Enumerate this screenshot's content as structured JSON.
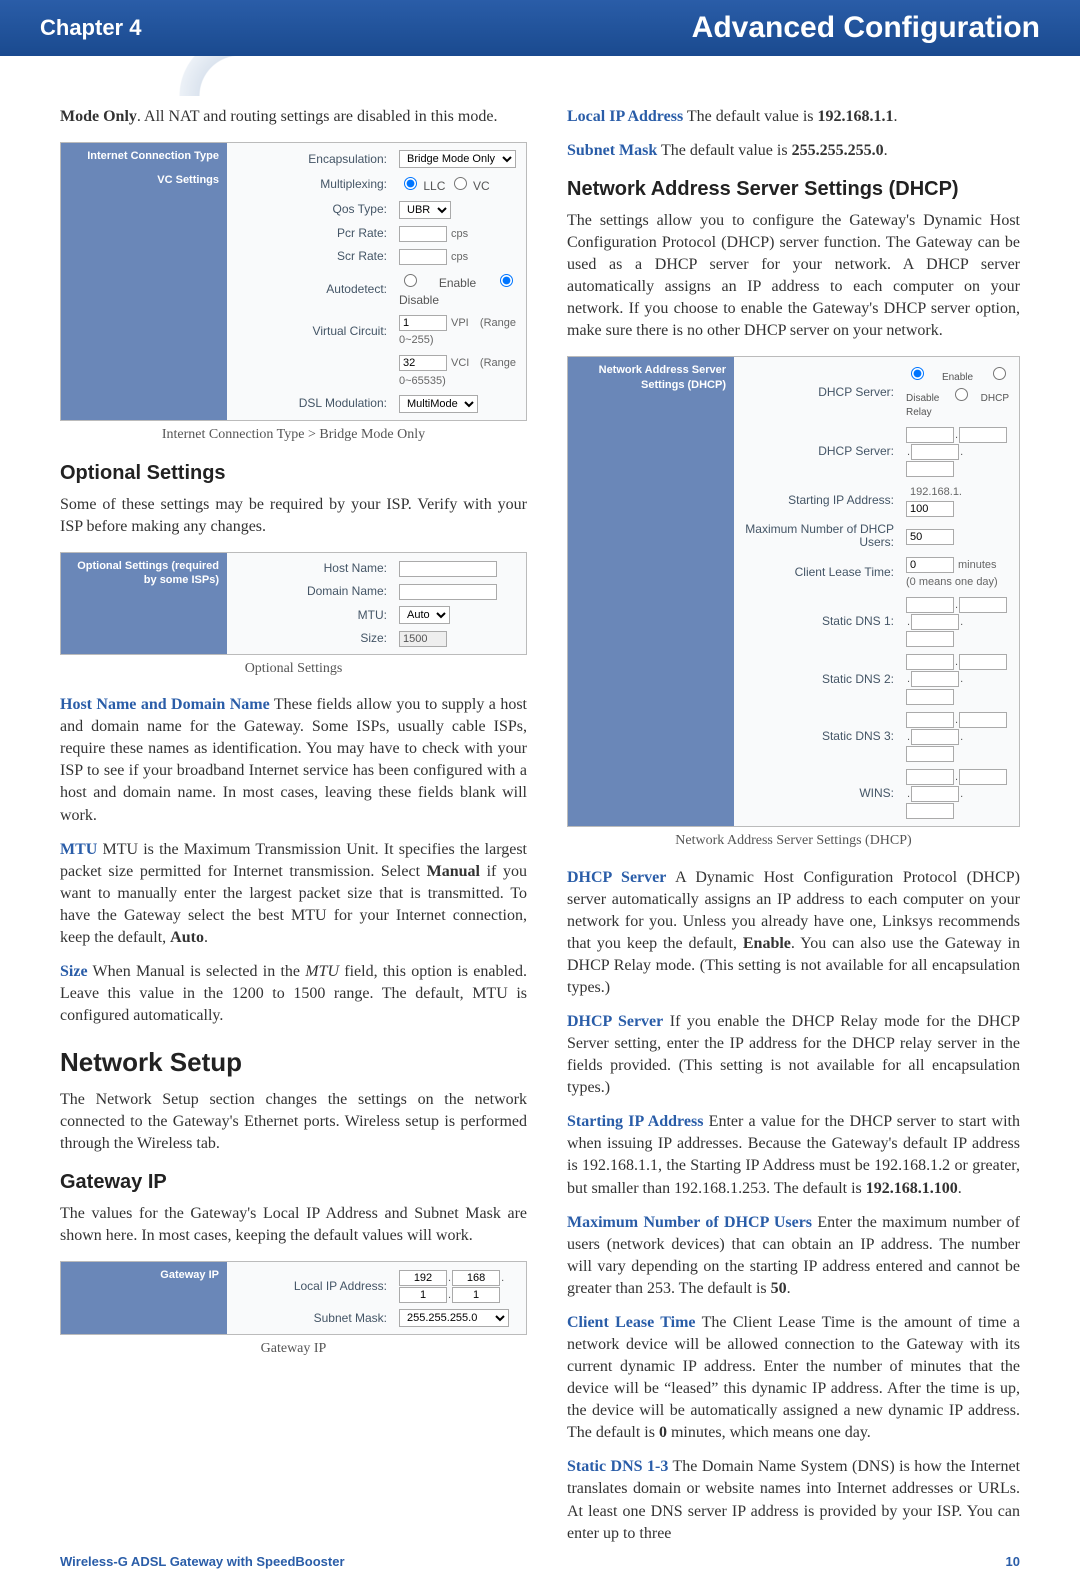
{
  "header": {
    "chapter": "Chapter 4",
    "title": "Advanced Configuration"
  },
  "footer": {
    "product": "Wireless-G ADSL Gateway with SpeedBooster",
    "page": "10"
  },
  "left": {
    "p1a": "Mode Only",
    "p1b": ". All NAT and routing settings are disabled in this mode.",
    "fig1": {
      "side1": "Internet Connection Type",
      "side2": "VC Settings",
      "l_enc": "Encapsulation:",
      "v_enc": "Bridge Mode Only",
      "l_mux": "Multiplexing:",
      "mux_llc": "LLC",
      "mux_vc": "VC",
      "l_qos": "Qos Type:",
      "v_qos": "UBR",
      "l_pcr": "Pcr Rate:",
      "u_pcr": "cps",
      "l_scr": "Scr Rate:",
      "u_scr": "cps",
      "l_auto": "Autodetect:",
      "auto_en": "Enable",
      "auto_dis": "Disable",
      "l_vc": "Virtual Circuit:",
      "v_vpi": "1",
      "u_vpi": "VPI (Range 0~255)",
      "v_vci": "32",
      "u_vci": "VCI (Range 0~65535)",
      "l_dsl": "DSL Modulation:",
      "v_dsl": "MultiMode"
    },
    "cap1": "Internet Connection Type > Bridge Mode Only",
    "h_opt": "Optional Settings",
    "p_opt": "Some of these settings may be required by your ISP. Verify with your ISP before making any changes.",
    "fig2": {
      "side": "Optional Settings (required by some ISPs)",
      "l_host": "Host Name:",
      "l_dom": "Domain Name:",
      "l_mtu": "MTU:",
      "v_mtu": "Auto",
      "l_size": "Size:",
      "v_size": "1500"
    },
    "cap2": "Optional Settings",
    "p_host_t": "Host Name and Domain Name",
    "p_host": "  These fields allow you to supply a host and domain name for the Gateway. Some ISPs, usually cable ISPs, require these names as identification. You may have to check with your ISP to see if your broadband Internet service has been configured with a host and domain name. In most cases, leaving these fields blank will work.",
    "p_mtu_t": "MTU",
    "p_mtu_a": "  MTU is the Maximum Transmission Unit. It specifies the largest packet size permitted for Internet transmission. Select ",
    "p_mtu_b": "Manual",
    "p_mtu_c": " if you want to manually enter the largest packet size that is transmitted. To have the Gateway select the best MTU for your Internet connection, keep the default, ",
    "p_mtu_d": "Auto",
    "p_size_t": "Size",
    "p_size_a": "  When Manual is selected in the ",
    "p_size_b": "MTU",
    "p_size_c": " field, this option is enabled. Leave this value in the 1200 to 1500 range. The default, MTU is configured automatically.",
    "h_net": "Network Setup",
    "p_net": "The Network Setup section changes the settings on the network connected to the Gateway's Ethernet ports. Wireless setup is performed through the Wireless tab.",
    "h_gw": "Gateway IP",
    "p_gw": "The values for the Gateway's Local IP Address and Subnet Mask are shown here. In most cases, keeping the default values will work.",
    "fig3": {
      "side": "Gateway IP",
      "l_ip": "Local IP Address:",
      "ip": [
        "192",
        "168",
        "1",
        "1"
      ],
      "l_mask": "Subnet Mask:",
      "v_mask": "255.255.255.0"
    },
    "cap3": "Gateway IP"
  },
  "right": {
    "p_lip_t": "Local IP Address",
    "p_lip_a": "  The default value is ",
    "p_lip_b": "192.168.1.1",
    "p_sm_t": "Subnet Mask",
    "p_sm_a": "  The default value is ",
    "p_sm_b": "255.255.255.0",
    "h_dhcp": "Network Address Server Settings (DHCP)",
    "p_dhcp": "The settings allow you to configure the Gateway's Dynamic Host Configuration Protocol (DHCP) server function. The Gateway can be used as a DHCP server for your network. A DHCP server automatically assigns an IP address to each computer on your network. If you choose to enable the Gateway's DHCP server option, make sure there is no other DHCP server on your network.",
    "fig4": {
      "side": "Network Address Server Settings (DHCP)",
      "l_srv": "DHCP Server:",
      "r_en": "Enable",
      "r_dis": "Disable",
      "r_rel": "DHCP Relay",
      "l_srv2": "DHCP Server:",
      "l_start": "Starting IP Address:",
      "start_pre": "192.168.1.",
      "start_val": "100",
      "l_max": "Maximum Number of DHCP Users:",
      "v_max": "50",
      "l_lease": "Client Lease Time:",
      "v_lease": "0",
      "u_lease": "minutes (0 means one day)",
      "l_d1": "Static DNS 1:",
      "l_d2": "Static DNS 2:",
      "l_d3": "Static DNS 3:",
      "l_wins": "WINS:"
    },
    "cap4": "Network Address Server Settings (DHCP)",
    "p_ds_t": "DHCP Server",
    "p_ds_a": "  A Dynamic Host Configuration Protocol (DHCP) server automatically assigns an IP address to each computer on your network for you. Unless you already have one, Linksys recommends that you keep the default, ",
    "p_ds_b": "Enable",
    "p_ds_c": ". You can also use the Gateway in DHCP Relay mode. (This setting is not available for all encapsulation types.)",
    "p_ds2_t": "DHCP Server",
    "p_ds2": "  If you enable the DHCP Relay mode for the DHCP Server setting, enter the IP address for the DHCP relay server in the fields provided. (This setting is not available for all encapsulation types.)",
    "p_si_t": "Starting IP Address",
    "p_si_a": "  Enter a value for the DHCP server to start with when issuing IP addresses. Because the Gateway's default IP address is 192.168.1.1, the Starting IP Address must be 192.168.1.2 or greater, but smaller than 192.168.1.253. The default is ",
    "p_si_b": "192.168.1.100",
    "p_mu_t": "Maximum Number of DHCP Users",
    "p_mu_a": "  Enter the maximum number of users (network devices) that can obtain an IP address. The number will vary depending on the starting IP address entered and cannot be greater than 253. The default is ",
    "p_mu_b": "50",
    "p_cl_t": "Client Lease Time",
    "p_cl_a": "  The Client Lease Time is the amount of time a network device will be allowed connection to the Gateway with its current dynamic IP address. Enter the number of minutes that the device will be “leased” this dynamic IP address. After the time is up, the device will be automatically assigned a new dynamic IP address. The default is ",
    "p_cl_b": "0",
    "p_cl_c": " minutes, which means one day.",
    "p_sd_t": "Static DNS 1-3",
    "p_sd": "  The Domain Name System (DNS) is how the Internet translates domain or website names into Internet addresses or URLs. At least one DNS server IP address is provided by your ISP. You can enter up to three"
  }
}
